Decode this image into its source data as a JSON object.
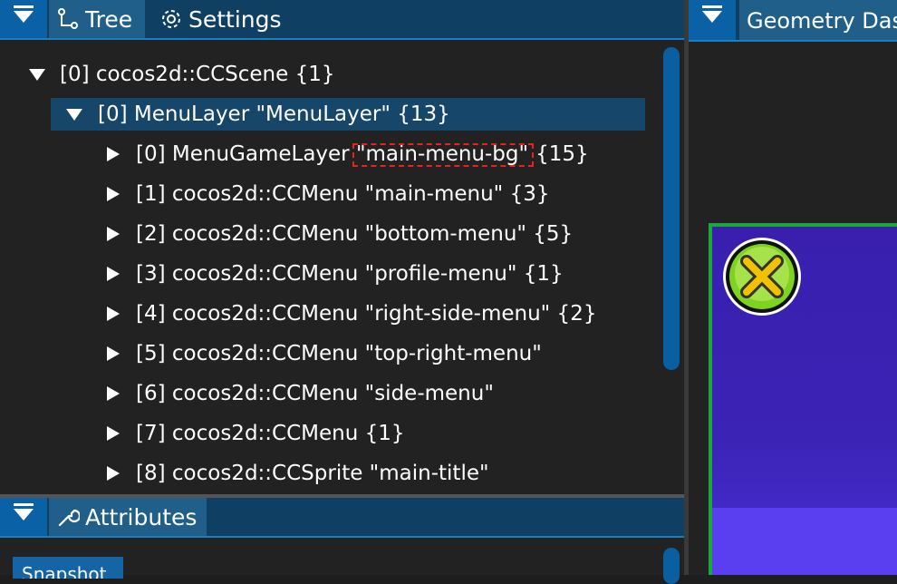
{
  "left_panel": {
    "tabs": [
      {
        "label": "Tree",
        "icon": "tree-icon",
        "active": true
      },
      {
        "label": "Settings",
        "icon": "gear-icon",
        "active": false
      }
    ],
    "tree": [
      {
        "text": "[0] cocos2d::CCScene {1}",
        "expanded": true,
        "depth": 0
      },
      {
        "text": "[0] MenuLayer \"MenuLayer\" {13}",
        "expanded": true,
        "depth": 1,
        "selected": true
      },
      {
        "text_before": "[0] MenuGameLayer ",
        "highlight": "\"main-menu-bg\"",
        "text_after": "{15}",
        "expanded": false,
        "depth": 2
      },
      {
        "text": "[1] cocos2d::CCMenu \"main-menu\" {3}",
        "expanded": false,
        "depth": 2
      },
      {
        "text": "[2] cocos2d::CCMenu \"bottom-menu\" {5}",
        "expanded": false,
        "depth": 2
      },
      {
        "text": "[3] cocos2d::CCMenu \"profile-menu\" {1}",
        "expanded": false,
        "depth": 2
      },
      {
        "text": "[4] cocos2d::CCMenu \"right-side-menu\" {2}",
        "expanded": false,
        "depth": 2
      },
      {
        "text": "[5] cocos2d::CCMenu \"top-right-menu\"",
        "expanded": false,
        "depth": 2
      },
      {
        "text": "[6] cocos2d::CCMenu \"side-menu\"",
        "expanded": false,
        "depth": 2
      },
      {
        "text": "[7] cocos2d::CCMenu {1}",
        "expanded": false,
        "depth": 2
      },
      {
        "text": "[8] cocos2d::CCSprite \"main-title\"",
        "expanded": false,
        "depth": 2
      }
    ],
    "attributes_tab": {
      "label": "Attributes",
      "icon": "wrench-icon"
    },
    "snapshot_label": "Snapshot"
  },
  "right_panel": {
    "tab_label": "Geometry Dash"
  },
  "colors": {
    "accent": "#0a61a5",
    "selection": "#16476a",
    "highlight_border": "#e8231e",
    "game_border": "#1aa83a",
    "game_bg": "#3a1fae"
  }
}
